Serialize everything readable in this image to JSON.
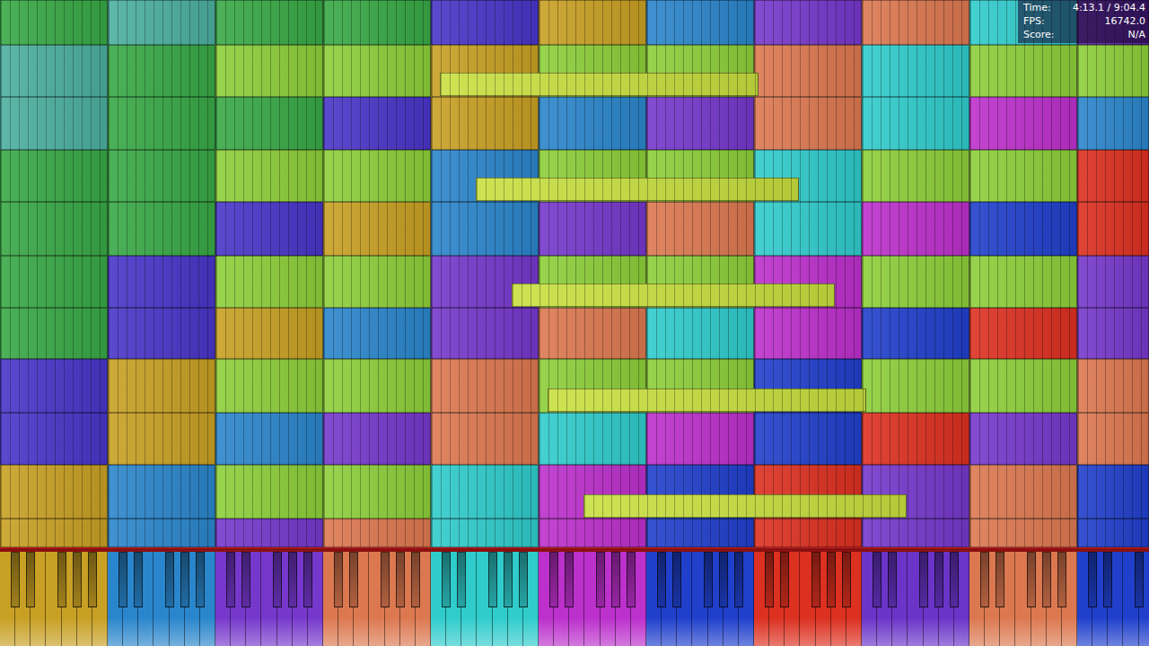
{
  "stats": [
    {
      "label": "Time:",
      "value": "4:13.1 / 9:04.4"
    },
    {
      "label": "FPS:",
      "value": "16742.0"
    },
    {
      "label": "Score:",
      "value": "N/A"
    }
  ],
  "grid": {
    "rows": [
      {
        "cells": [
          {
            "color": "#38a845"
          },
          {
            "color": "#4cb0a0"
          },
          {
            "color": "#38a845"
          },
          {
            "color": "#38a845"
          },
          {
            "color": "#4a36c8"
          },
          {
            "color": "#c8a024"
          },
          {
            "color": "#2a86cc"
          },
          {
            "color": "#7638cc"
          },
          {
            "color": "#dc7850"
          },
          {
            "color": "#30cccc"
          },
          {
            "color": "#5a2aa0"
          }
        ]
      },
      {
        "cells": [
          {
            "color": "#4cb0a0"
          },
          {
            "color": "#38a845"
          },
          {
            "color": "#8ccf3a"
          },
          {
            "color": "#8ccf3a"
          },
          {
            "color": "#c8a024"
          },
          {
            "color": "#8ccf3a"
          },
          {
            "color": "#8ccf3a"
          },
          {
            "color": "#dc7850"
          },
          {
            "color": "#30cccc"
          },
          {
            "color": "#8ccf3a"
          },
          {
            "color": "#8ccf3a"
          }
        ]
      },
      {
        "cells": [
          {
            "color": "#4cb0a0"
          },
          {
            "color": "#38a845"
          },
          {
            "color": "#38a845"
          },
          {
            "color": "#4a36c8"
          },
          {
            "color": "#c8a024"
          },
          {
            "color": "#2a86cc"
          },
          {
            "color": "#7638cc"
          },
          {
            "color": "#dc7850"
          },
          {
            "color": "#30cccc"
          },
          {
            "color": "#bc30cc"
          },
          {
            "color": "#2a86cc"
          }
        ]
      },
      {
        "cells": [
          {
            "color": "#38a845"
          },
          {
            "color": "#38a845"
          },
          {
            "color": "#8ccf3a"
          },
          {
            "color": "#8ccf3a"
          },
          {
            "color": "#2a86cc"
          },
          {
            "color": "#8ccf3a"
          },
          {
            "color": "#8ccf3a"
          },
          {
            "color": "#30cccc"
          },
          {
            "color": "#8ccf3a"
          },
          {
            "color": "#8ccf3a"
          },
          {
            "color": "#dc3020"
          }
        ]
      },
      {
        "cells": [
          {
            "color": "#38a845"
          },
          {
            "color": "#38a845"
          },
          {
            "color": "#4a36c8"
          },
          {
            "color": "#c8a024"
          },
          {
            "color": "#2a86cc"
          },
          {
            "color": "#7638cc"
          },
          {
            "color": "#dc7850"
          },
          {
            "color": "#30cccc"
          },
          {
            "color": "#bc30cc"
          },
          {
            "color": "#2040cc"
          },
          {
            "color": "#dc3020"
          }
        ]
      },
      {
        "cells": [
          {
            "color": "#38a845"
          },
          {
            "color": "#4a36c8"
          },
          {
            "color": "#8ccf3a"
          },
          {
            "color": "#8ccf3a"
          },
          {
            "color": "#7638cc"
          },
          {
            "color": "#8ccf3a"
          },
          {
            "color": "#8ccf3a"
          },
          {
            "color": "#bc30cc"
          },
          {
            "color": "#8ccf3a"
          },
          {
            "color": "#8ccf3a"
          },
          {
            "color": "#7638cc"
          }
        ]
      },
      {
        "cells": [
          {
            "color": "#38a845"
          },
          {
            "color": "#4a36c8"
          },
          {
            "color": "#c8a024"
          },
          {
            "color": "#2a86cc"
          },
          {
            "color": "#7638cc"
          },
          {
            "color": "#dc7850"
          },
          {
            "color": "#30cccc"
          },
          {
            "color": "#bc30cc"
          },
          {
            "color": "#2040cc"
          },
          {
            "color": "#dc3020"
          },
          {
            "color": "#7638cc"
          }
        ]
      },
      {
        "cells": [
          {
            "color": "#4a36c8"
          },
          {
            "color": "#c8a024"
          },
          {
            "color": "#8ccf3a"
          },
          {
            "color": "#8ccf3a"
          },
          {
            "color": "#dc7850"
          },
          {
            "color": "#8ccf3a"
          },
          {
            "color": "#8ccf3a"
          },
          {
            "color": "#2040cc"
          },
          {
            "color": "#8ccf3a"
          },
          {
            "color": "#8ccf3a"
          },
          {
            "color": "#dc7850"
          }
        ]
      },
      {
        "cells": [
          {
            "color": "#4a36c8"
          },
          {
            "color": "#c8a024"
          },
          {
            "color": "#2a86cc"
          },
          {
            "color": "#7638cc"
          },
          {
            "color": "#dc7850"
          },
          {
            "color": "#30cccc"
          },
          {
            "color": "#bc30cc"
          },
          {
            "color": "#2040cc"
          },
          {
            "color": "#dc3020"
          },
          {
            "color": "#7638cc"
          },
          {
            "color": "#dc7850"
          }
        ]
      },
      {
        "cells": [
          {
            "color": "#c8a024"
          },
          {
            "color": "#2a86cc"
          },
          {
            "color": "#8ccf3a"
          },
          {
            "color": "#8ccf3a"
          },
          {
            "color": "#30cccc"
          },
          {
            "color": "#bc30cc"
          },
          {
            "color": "#2040cc"
          },
          {
            "color": "#dc3020"
          },
          {
            "color": "#7638cc"
          },
          {
            "color": "#dc7850"
          },
          {
            "color": "#2040cc"
          }
        ]
      },
      {
        "cells": [
          {
            "color": "#c8a024"
          },
          {
            "color": "#2a86cc"
          },
          {
            "color": "#7638cc"
          },
          {
            "color": "#dc7850"
          },
          {
            "color": "#30cccc"
          },
          {
            "color": "#bc30cc"
          },
          {
            "color": "#2040cc"
          },
          {
            "color": "#dc3020"
          },
          {
            "color": "#7638cc"
          },
          {
            "color": "#dc7850"
          },
          {
            "color": "#2040cc"
          }
        ]
      }
    ]
  },
  "long_notes": [
    {
      "row": 1,
      "start": 4.08,
      "end": 7.04,
      "color": "#c8e040"
    },
    {
      "row": 3,
      "start": 4.42,
      "end": 7.42,
      "color": "#c8e040"
    },
    {
      "row": 5,
      "start": 4.75,
      "end": 7.75,
      "color": "#c8e040"
    },
    {
      "row": 7,
      "start": 5.08,
      "end": 8.04,
      "color": "#c8e040"
    },
    {
      "row": 9,
      "start": 5.42,
      "end": 8.42,
      "color": "#c8e040"
    }
  ],
  "keyboard": {
    "octaves": [
      {
        "color": "#c8a024"
      },
      {
        "color": "#2a86cc"
      },
      {
        "color": "#7638cc"
      },
      {
        "color": "#dc7850"
      },
      {
        "color": "#30cccc"
      },
      {
        "color": "#bc30cc"
      },
      {
        "color": "#2040cc"
      },
      {
        "color": "#dc3020"
      },
      {
        "color": "#6a34c8"
      },
      {
        "color": "#dc7850"
      },
      {
        "color": "#2040cc"
      }
    ]
  }
}
